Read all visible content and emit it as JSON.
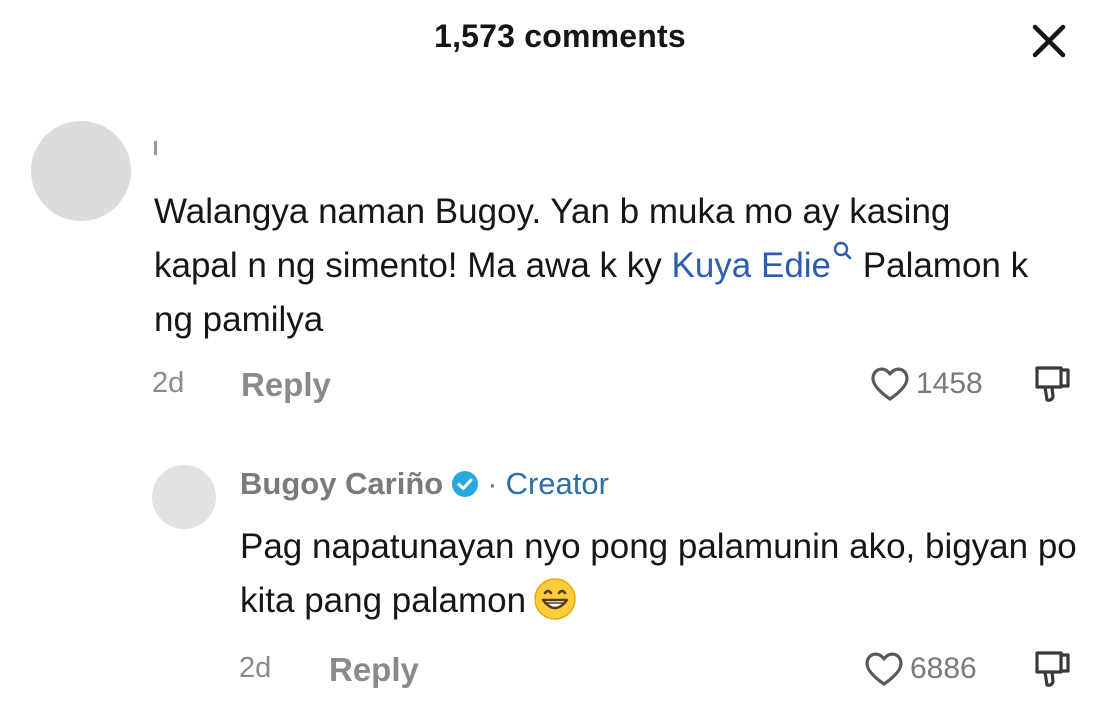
{
  "header": {
    "title": "1,573 comments"
  },
  "icons": {
    "close": "close-icon",
    "like": "heart-outline-icon",
    "dislike": "thumbs-down-icon",
    "verified": "verified-badge-icon",
    "mention": "search-icon",
    "emoji": "grinning-face-emoji"
  },
  "colors": {
    "link": "#2b5db2",
    "creator": "#2c6fa6",
    "verified": "#29a8e0"
  },
  "comment": {
    "username": "ı",
    "text_part1": "Walangya naman Bugoy. Yan b muka mo ay kasing kapal n ng simento! Ma awa k ky ",
    "mention": "Kuya Edie",
    "text_part2": " Palamon k ng pamilya",
    "time": "2d",
    "reply_label": "Reply",
    "likes": "1458"
  },
  "reply": {
    "username": "Bugoy Cariño",
    "separator": "·",
    "badge": "Creator",
    "text": "Pag napatunayan nyo pong palamunin ako, bigyan po kita pang palamon",
    "time": "2d",
    "reply_label": "Reply",
    "likes": "6886"
  }
}
